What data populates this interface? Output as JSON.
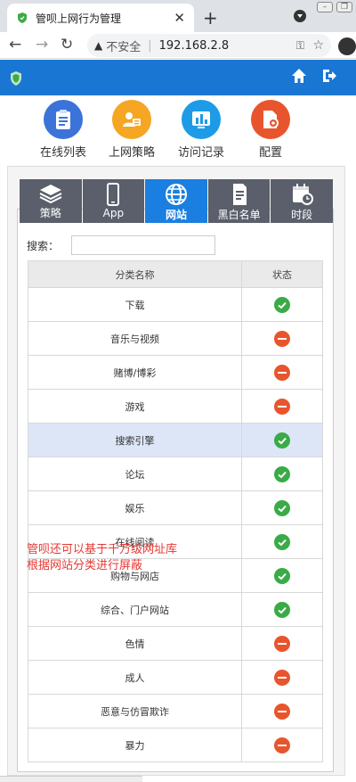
{
  "browser": {
    "tab_title": "管呗上网行为管理",
    "insecure_label": "不安全",
    "url": "192.168.2.8"
  },
  "topnav": [
    {
      "label": "在线列表",
      "color": "#3b73d9"
    },
    {
      "label": "上网策略",
      "color": "#f5a623"
    },
    {
      "label": "访问记录",
      "color": "#1e9be6"
    },
    {
      "label": "配置",
      "color": "#e8552d"
    }
  ],
  "tabs": [
    {
      "label": "策略",
      "icon": "layers-icon"
    },
    {
      "label": "App",
      "icon": "phone-icon"
    },
    {
      "label": "网站",
      "icon": "globe-icon"
    },
    {
      "label": "黑白名单",
      "icon": "document-icon"
    },
    {
      "label": "时段",
      "icon": "calendar-clock-icon"
    }
  ],
  "search": {
    "label": "搜索：",
    "value": ""
  },
  "table": {
    "headers": [
      "分类名称",
      "状态"
    ],
    "rows": [
      {
        "name": "下载",
        "status": "allowed"
      },
      {
        "name": "音乐与视频",
        "status": "blocked"
      },
      {
        "name": "赌博/博彩",
        "status": "blocked"
      },
      {
        "name": "游戏",
        "status": "blocked"
      },
      {
        "name": "搜索引擎",
        "status": "allowed"
      },
      {
        "name": "论坛",
        "status": "allowed"
      },
      {
        "name": "娱乐",
        "status": "allowed"
      },
      {
        "name": "在线阅读",
        "status": "allowed"
      },
      {
        "name": "购物与网店",
        "status": "allowed"
      },
      {
        "name": "综合、门户网站",
        "status": "allowed"
      },
      {
        "name": "色情",
        "status": "blocked"
      },
      {
        "name": "成人",
        "status": "blocked"
      },
      {
        "name": "恶意与仿冒欺诈",
        "status": "blocked"
      },
      {
        "name": "暴力",
        "status": "blocked"
      }
    ]
  },
  "annotation": {
    "line1": "管呗还可以基于千万级网址库",
    "line2": "根据网站分类进行屏蔽"
  },
  "colors": {
    "header": "#1976d2",
    "active_tab": "#1a7fe0",
    "tab": "#5a5f6b",
    "allowed": "#3aab46",
    "blocked": "#e8552d",
    "annotation": "#e53935"
  }
}
